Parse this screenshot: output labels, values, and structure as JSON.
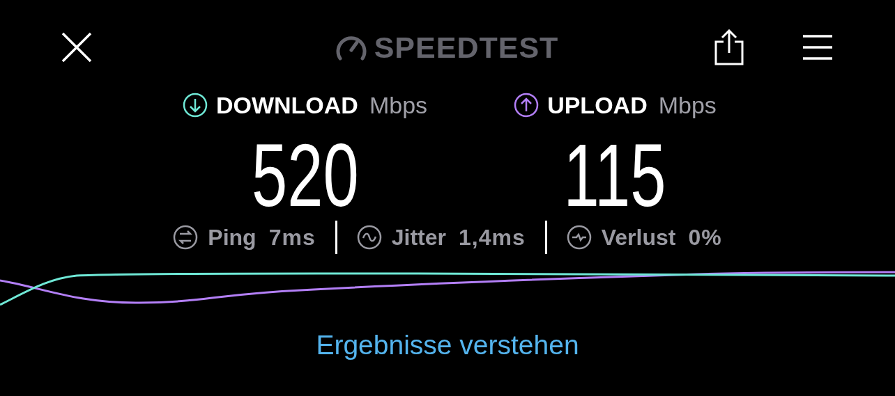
{
  "header": {
    "logo": "SPEEDTEST"
  },
  "measures": [
    {
      "kind": "download",
      "label": "DOWNLOAD",
      "unit": "Mbps",
      "value": "520",
      "color": "#6fe8d6"
    },
    {
      "kind": "upload",
      "label": "UPLOAD",
      "unit": "Mbps",
      "value": "115",
      "color": "#b37ff7"
    }
  ],
  "stats": [
    {
      "kind": "ping",
      "label": "Ping",
      "value": "7ms"
    },
    {
      "kind": "jitter",
      "label": "Jitter",
      "value": "1,4ms"
    },
    {
      "kind": "loss",
      "label": "Verlust",
      "value": "0%"
    }
  ],
  "link": "Ergebnisse verstehen"
}
